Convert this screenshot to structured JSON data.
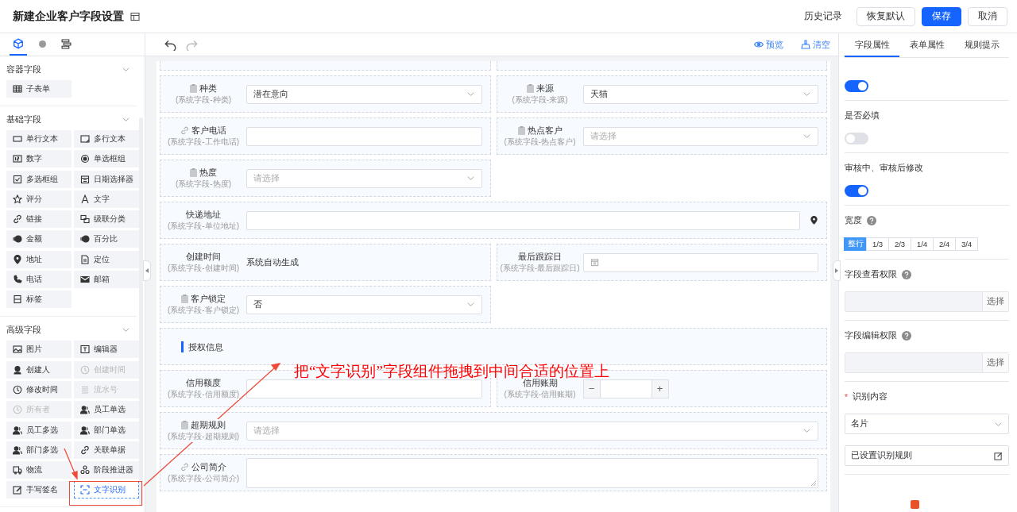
{
  "header": {
    "title": "新建企业客户字段设置",
    "actions": [
      {
        "label": "历史记录",
        "kind": "link"
      },
      {
        "label": "恢复默认",
        "kind": "default"
      },
      {
        "label": "保存",
        "kind": "primary"
      },
      {
        "label": "取消",
        "kind": "default"
      }
    ]
  },
  "sidebar": {
    "tabs": [
      {
        "selected": true
      },
      {
        "selected": false
      },
      {
        "selected": false
      }
    ],
    "groups": [
      {
        "title": "容器字段",
        "items": [
          {
            "label": "子表单"
          }
        ]
      },
      {
        "title": "基础字段",
        "items": [
          {
            "label": "单行文本"
          },
          {
            "label": "多行文本"
          },
          {
            "label": "数字"
          },
          {
            "label": "单选框组"
          },
          {
            "label": "多选框组"
          },
          {
            "label": "日期选择器"
          },
          {
            "label": "评分"
          },
          {
            "label": "文字"
          },
          {
            "label": "链接"
          },
          {
            "label": "级联分类"
          },
          {
            "label": "金额"
          },
          {
            "label": "百分比"
          },
          {
            "label": "地址"
          },
          {
            "label": "定位"
          },
          {
            "label": "电话"
          },
          {
            "label": "邮箱"
          },
          {
            "label": "标签"
          }
        ]
      },
      {
        "title": "高级字段",
        "items": [
          {
            "label": "图片",
            "disabled": false,
            "selected": false
          },
          {
            "label": "编辑器",
            "disabled": false,
            "selected": false
          },
          {
            "label": "创建人",
            "disabled": false,
            "selected": false
          },
          {
            "label": "创建时间",
            "disabled": true,
            "selected": false
          },
          {
            "label": "修改时间",
            "disabled": false,
            "selected": false
          },
          {
            "label": "流水号",
            "disabled": true,
            "selected": false
          },
          {
            "label": "所有者",
            "disabled": true,
            "selected": false
          },
          {
            "label": "员工单选",
            "disabled": false,
            "selected": false
          },
          {
            "label": "员工多选",
            "disabled": false,
            "selected": false
          },
          {
            "label": "部门单选",
            "disabled": false,
            "selected": false
          },
          {
            "label": "部门多选",
            "disabled": false,
            "selected": false
          },
          {
            "label": "关联单据",
            "disabled": false,
            "selected": false
          },
          {
            "label": "物流",
            "disabled": false,
            "selected": false
          },
          {
            "label": "阶段推进器",
            "disabled": false,
            "selected": false
          },
          {
            "label": "手写签名",
            "disabled": false,
            "selected": false
          },
          {
            "label": "文字识别",
            "disabled": false,
            "selected": true
          }
        ]
      }
    ]
  },
  "toolbar": {
    "actions": [
      {
        "label": "预览"
      },
      {
        "label": "清空"
      }
    ]
  },
  "form": {
    "rows": [
      {
        "kind": "stub",
        "cells": [
          {},
          {}
        ]
      },
      {
        "kind": "fields",
        "cells": [
          {
            "label": "种类",
            "sublabel": "(系统字段-种类)",
            "kind": "system",
            "control": {
              "kind": "select",
              "value": "潜在意向"
            }
          },
          {
            "label": "来源",
            "sublabel": "(系统字段-来源)",
            "kind": "system",
            "control": {
              "kind": "select",
              "value": "天猫"
            }
          }
        ]
      },
      {
        "kind": "fields",
        "cells": [
          {
            "label": "客户电话",
            "sublabel": "(系统字段-工作电话)",
            "kind": "linked",
            "control": {
              "kind": "input"
            }
          },
          {
            "label": "热点客户",
            "sublabel": "(系统字段-热点客户)",
            "kind": "system",
            "control": {
              "kind": "select",
              "placeholder": "请选择"
            }
          }
        ]
      },
      {
        "kind": "fields",
        "cells": [
          {
            "label": "热度",
            "sublabel": "(系统字段-热度)",
            "kind": "system",
            "control": {
              "kind": "select",
              "placeholder": "请选择"
            }
          }
        ]
      },
      {
        "kind": "fields",
        "cells": [
          {
            "label": "快递地址",
            "sublabel": "(系统字段-单位地址)",
            "kind": "plain",
            "full": true,
            "control": {
              "kind": "address"
            }
          }
        ]
      },
      {
        "kind": "fields",
        "cells": [
          {
            "label": "创建时间",
            "sublabel": "(系统字段-创建时间)",
            "kind": "plain",
            "control": {
              "kind": "text",
              "value": "系统自动生成"
            }
          },
          {
            "label": "最后跟踪日",
            "sublabel": "(系统字段-最后跟踪日)",
            "kind": "plain",
            "control": {
              "kind": "date"
            }
          }
        ]
      },
      {
        "kind": "fields",
        "cells": [
          {
            "label": "客户锁定",
            "sublabel": "(系统字段-客户锁定)",
            "kind": "system",
            "control": {
              "kind": "select",
              "value": "否"
            }
          }
        ]
      },
      {
        "kind": "section",
        "title": "授权信息"
      },
      {
        "kind": "fields",
        "cells": [
          {
            "label": "信用额度",
            "sublabel": "(系统字段-信用额度)",
            "kind": "plain",
            "control": {
              "kind": "input"
            }
          },
          {
            "label": "信用账期",
            "sublabel": "(系统字段-信用账期)",
            "kind": "plain",
            "control": {
              "kind": "stepper",
              "minus": "−",
              "plus": "+"
            }
          }
        ]
      },
      {
        "kind": "fields",
        "cells": [
          {
            "label": "超期规则",
            "sublabel": "(系统字段-超期规则)",
            "kind": "system",
            "full": true,
            "control": {
              "kind": "select",
              "placeholder": "请选择"
            }
          }
        ]
      },
      {
        "kind": "fields",
        "cells": [
          {
            "label": "公司简介",
            "sublabel": "(系统字段-公司简介)",
            "kind": "linked",
            "full": true,
            "control": {
              "kind": "textarea"
            }
          }
        ]
      }
    ]
  },
  "panel": {
    "tabs": [
      {
        "label": "字段属性",
        "selected": true
      },
      {
        "label": "表单属性",
        "selected": false
      },
      {
        "label": "规则提示",
        "selected": false
      }
    ],
    "sections": [
      {
        "kind": "toggle",
        "on": true
      },
      {
        "kind": "toggle",
        "label": "是否必填",
        "on": false
      },
      {
        "kind": "toggle",
        "label": "审核中、审核后修改",
        "on": true
      },
      {
        "kind": "segments",
        "label": "宽度",
        "help": true,
        "options": [
          {
            "label": "整行",
            "selected": true
          },
          {
            "label": "1/3",
            "selected": false
          },
          {
            "label": "2/3",
            "selected": false
          },
          {
            "label": "1/4",
            "selected": false
          },
          {
            "label": "2/4",
            "selected": false
          },
          {
            "label": "3/4",
            "selected": false
          }
        ]
      },
      {
        "kind": "picker",
        "label": "字段查看权限",
        "help": true,
        "button": "选择"
      },
      {
        "kind": "picker",
        "label": "字段编辑权限",
        "help": true,
        "button": "选择"
      },
      {
        "kind": "recognition",
        "label": "识别内容",
        "required": true,
        "required_mark": "*",
        "select": "名片",
        "rule": "已设置识别规则"
      }
    ]
  },
  "annotation": {
    "text": "把“文字识别”字段组件拖拽到中间合适的位置上"
  }
}
